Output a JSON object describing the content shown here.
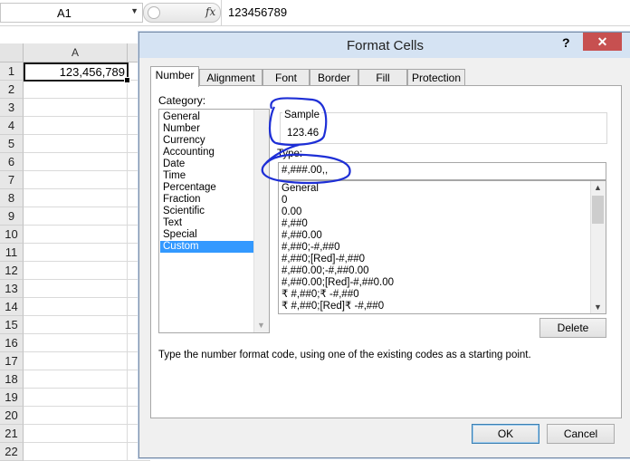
{
  "formula_bar": {
    "name_box": "A1",
    "fx_label": "fx",
    "formula_value": "123456789"
  },
  "sheet": {
    "column_headers": [
      "A"
    ],
    "row_numbers": [
      "1",
      "2",
      "3",
      "4",
      "5",
      "6",
      "7",
      "8",
      "9",
      "10",
      "11",
      "12",
      "13",
      "14",
      "15",
      "16",
      "17",
      "18",
      "19",
      "20",
      "21",
      "22"
    ],
    "cell_a1": "123,456,789"
  },
  "dialog": {
    "title": "Format Cells",
    "help": "?",
    "close": "✕",
    "tabs": [
      "Number",
      "Alignment",
      "Font",
      "Border",
      "Fill",
      "Protection"
    ],
    "active_tab": "Number",
    "category_label": "Category:",
    "categories": [
      "General",
      "Number",
      "Currency",
      "Accounting",
      "Date",
      "Time",
      "Percentage",
      "Fraction",
      "Scientific",
      "Text",
      "Special",
      "Custom"
    ],
    "selected_category": "Custom",
    "sample_label": "Sample",
    "sample_value": "123.46",
    "type_label": "Type:",
    "type_value": "#,###.00,,",
    "format_codes": [
      "General",
      "0",
      "0.00",
      "#,##0",
      "#,##0.00",
      "#,##0;-#,##0",
      "#,##0;[Red]-#,##0",
      "#,##0.00;-#,##0.00",
      "#,##0.00;[Red]-#,##0.00",
      "₹ #,##0;₹ -#,##0",
      "₹ #,##0;[Red]₹ -#,##0"
    ],
    "delete_label": "Delete",
    "hint": "Type the number format code, using one of the existing codes as a starting point.",
    "ok_label": "OK",
    "cancel_label": "Cancel"
  },
  "colors": {
    "selection": "#3399ff",
    "close_button": "#c75050",
    "annotation_ink": "#1e2fd6"
  }
}
